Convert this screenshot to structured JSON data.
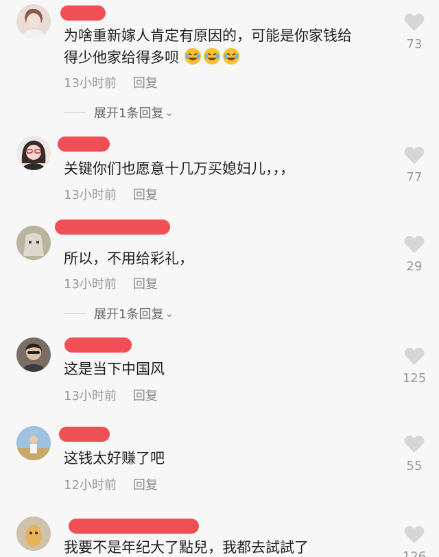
{
  "comments": [
    {
      "username": "",
      "text_lines": [
        "为啥重新嫁人肯定有原因的，可能是你家钱给",
        "得少他家给得多呗"
      ],
      "emoji": [
        "rolling-laugh-emoji",
        "rolling-laugh-emoji",
        "rolling-laugh-emoji"
      ],
      "time": "13小时前",
      "reply_label": "回复",
      "likes": "73",
      "expand_label": "展开1条回复"
    },
    {
      "username": "",
      "text": "关键你们也愿意十几万买媳妇儿，，，",
      "time": "13小时前",
      "reply_label": "回复",
      "likes": "77"
    },
    {
      "username": "",
      "text": "所以，不用给彩礼，",
      "time": "13小时前",
      "reply_label": "回复",
      "likes": "29",
      "expand_label": "展开1条回复"
    },
    {
      "username": "",
      "text": "这是当下中国风",
      "time": "13小时前",
      "reply_label": "回复",
      "likes": "125"
    },
    {
      "username": "",
      "text": "这钱太好赚了吧",
      "time": "12小时前",
      "reply_label": "回复",
      "likes": "55"
    },
    {
      "username": "",
      "text": "我要不是年纪大了點兒，我都去試試了",
      "likes": "126"
    }
  ],
  "colors": {
    "background": "#f7f7f7",
    "redaction": "#f04f56",
    "muted_text": "#9a9a9a",
    "heart": "#d6d6d6"
  },
  "icons": {
    "like": "heart-icon",
    "expand": "chevron-down-icon"
  }
}
